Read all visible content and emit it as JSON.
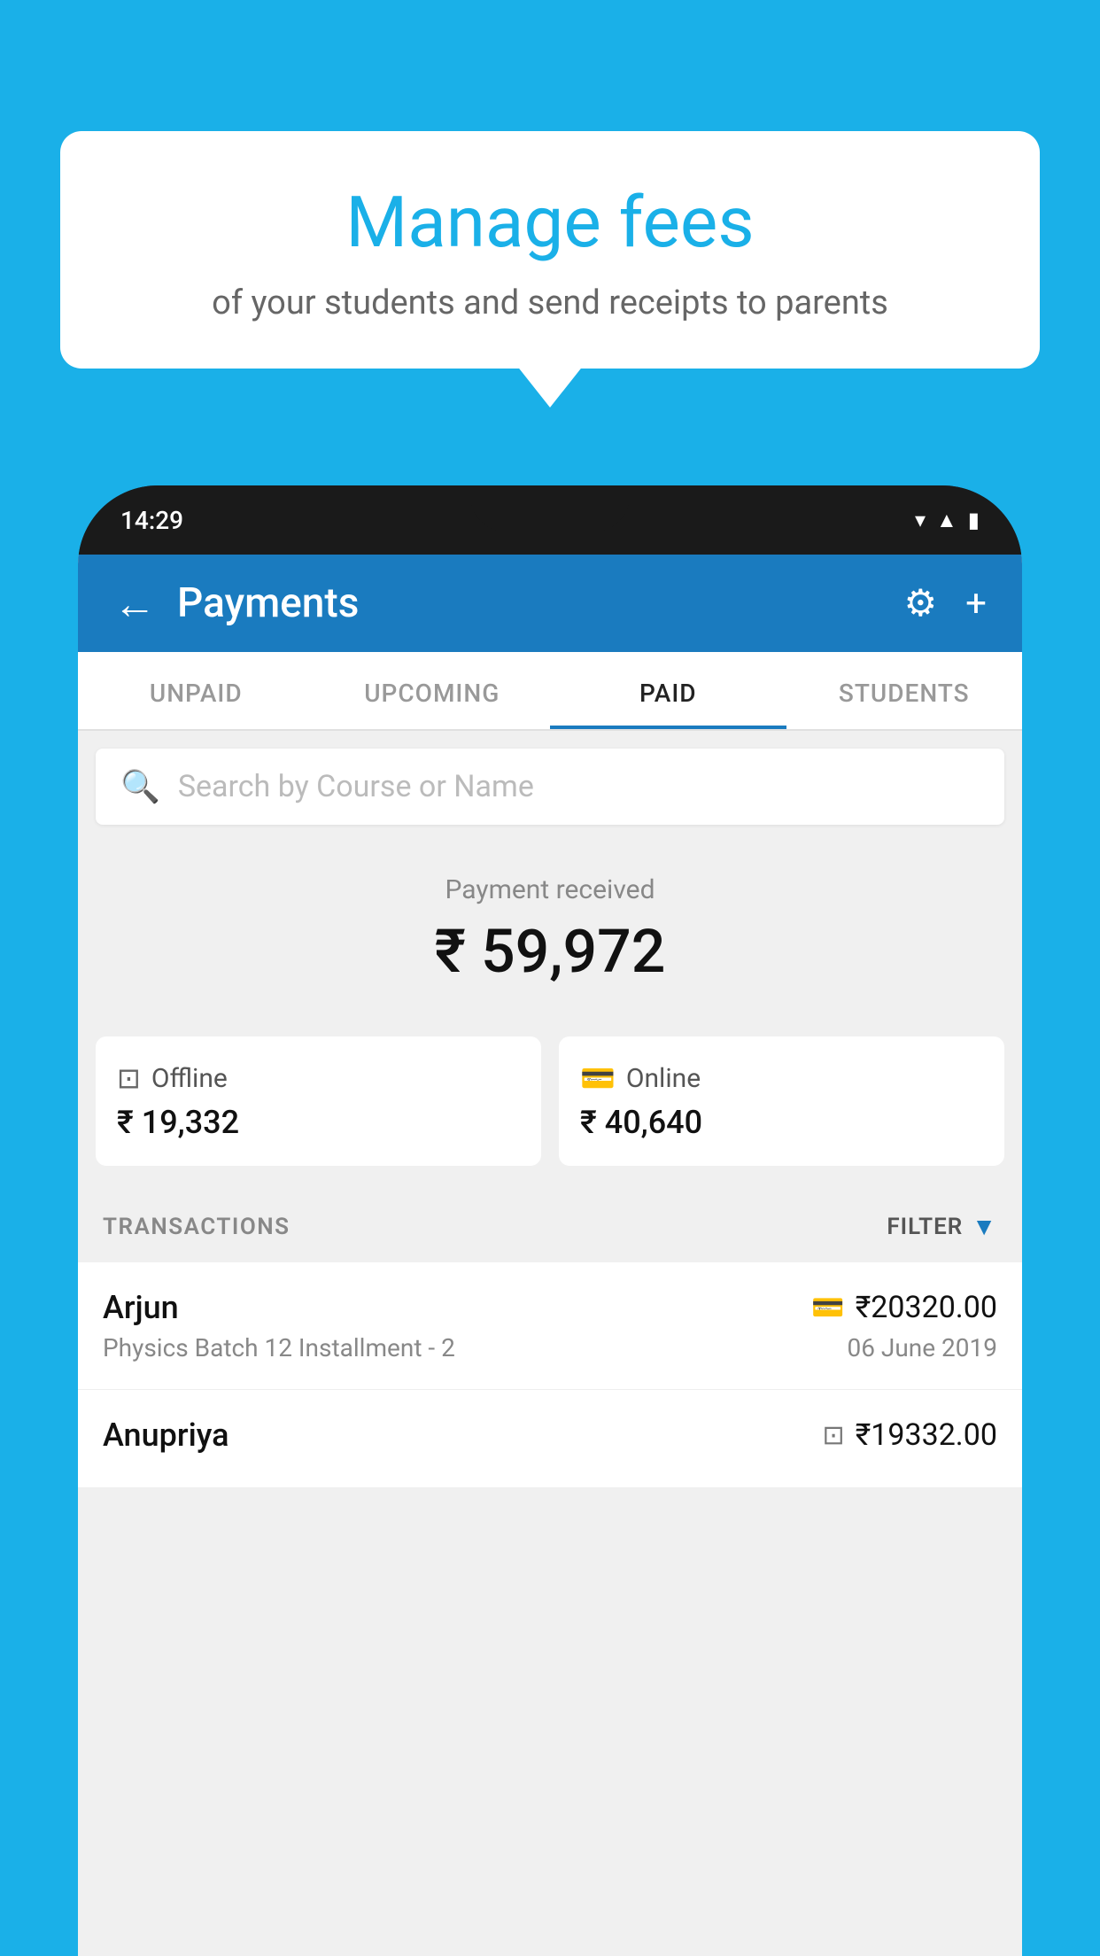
{
  "background_color": "#1ab0e8",
  "speech_bubble": {
    "title": "Manage fees",
    "subtitle": "of your students and send receipts to parents"
  },
  "phone": {
    "status_bar": {
      "time": "14:29",
      "icons": [
        "wifi",
        "signal",
        "battery"
      ]
    },
    "app_bar": {
      "back_icon": "←",
      "title": "Payments",
      "settings_icon": "⚙",
      "add_icon": "+"
    },
    "tabs": [
      {
        "label": "UNPAID",
        "active": false
      },
      {
        "label": "UPCOMING",
        "active": false
      },
      {
        "label": "PAID",
        "active": true
      },
      {
        "label": "STUDENTS",
        "active": false
      }
    ],
    "search": {
      "placeholder": "Search by Course or Name",
      "icon": "🔍"
    },
    "payment_summary": {
      "label": "Payment received",
      "total": "₹ 59,972",
      "offline_label": "Offline",
      "offline_amount": "₹ 19,332",
      "online_label": "Online",
      "online_amount": "₹ 40,640"
    },
    "transactions": {
      "header_label": "TRANSACTIONS",
      "filter_label": "FILTER",
      "items": [
        {
          "name": "Arjun",
          "course": "Physics Batch 12 Installment - 2",
          "amount": "₹20320.00",
          "date": "06 June 2019",
          "payment_type": "card"
        },
        {
          "name": "Anupriya",
          "course": "",
          "amount": "₹19332.00",
          "date": "",
          "payment_type": "offline"
        }
      ]
    }
  }
}
